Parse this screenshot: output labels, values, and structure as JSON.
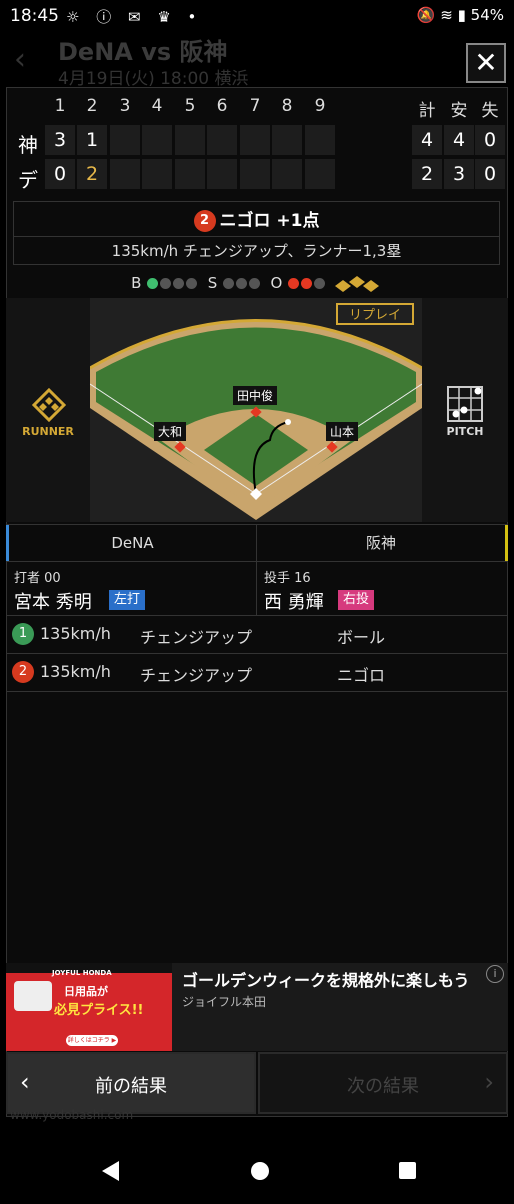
{
  "status_bar": {
    "time": "18:45",
    "battery": "54%"
  },
  "background_header": {
    "title": "DeNA vs 阪神",
    "subtitle": "4月19日(火) 18:00 横浜"
  },
  "close_label": "✕",
  "scoreboard": {
    "innings": [
      "1",
      "2",
      "3",
      "4",
      "5",
      "6",
      "7",
      "8",
      "9"
    ],
    "totals_headers": [
      "計",
      "安",
      "失"
    ],
    "rows": [
      {
        "team": "神",
        "scores": [
          "3",
          "1",
          "",
          "",
          "",
          "",
          "",
          "",
          ""
        ],
        "totals": [
          "4",
          "4",
          "0"
        ]
      },
      {
        "team": "デ",
        "scores": [
          "0",
          "2",
          "",
          "",
          "",
          "",
          "",
          "",
          ""
        ],
        "totals": [
          "2",
          "3",
          "0"
        ]
      }
    ]
  },
  "play": {
    "number": "2",
    "result": "ニゴロ +1点",
    "detail": "135km/h チェンジアップ、ランナー1,3塁"
  },
  "count": {
    "b_label": "B",
    "s_label": "S",
    "o_label": "O"
  },
  "field": {
    "replay_label": "リプレイ",
    "runner_label": "RUNNER",
    "pitch_label": "PITCH",
    "positions": [
      "田中俊",
      "大和",
      "山本"
    ]
  },
  "tabs": [
    "DeNA",
    "阪神"
  ],
  "batter": {
    "role": "打者 00",
    "name": "宮本 秀明",
    "hand": "左打"
  },
  "pitcher": {
    "role": "投手 16",
    "name": "西 勇輝",
    "hand": "右投"
  },
  "pitches": [
    {
      "num": "1",
      "speed": "135km/h",
      "type": "チェンジアップ",
      "result": "ボール"
    },
    {
      "num": "2",
      "speed": "135km/h",
      "type": "チェンジアップ",
      "result": "ニゴロ"
    }
  ],
  "ad": {
    "title": "ゴールデンウィークを規格外に楽しもう",
    "sponsor": "ジョイフル本田",
    "image_brand": "JOYFUL HONDA",
    "image_line1": "日用品が",
    "image_line2": "必見プライス!!",
    "image_cta": "詳しくはコチラ ▶"
  },
  "nav": {
    "prev": "前の結果",
    "next": "次の結果"
  },
  "watermark": "www.yodobashi.com",
  "colors": {
    "accent_red": "#d63a1f",
    "accent_green": "#3a9a56",
    "gold": "#d4a835",
    "batter_badge": "#2a6fc9",
    "pitcher_badge": "#d63a7e"
  }
}
